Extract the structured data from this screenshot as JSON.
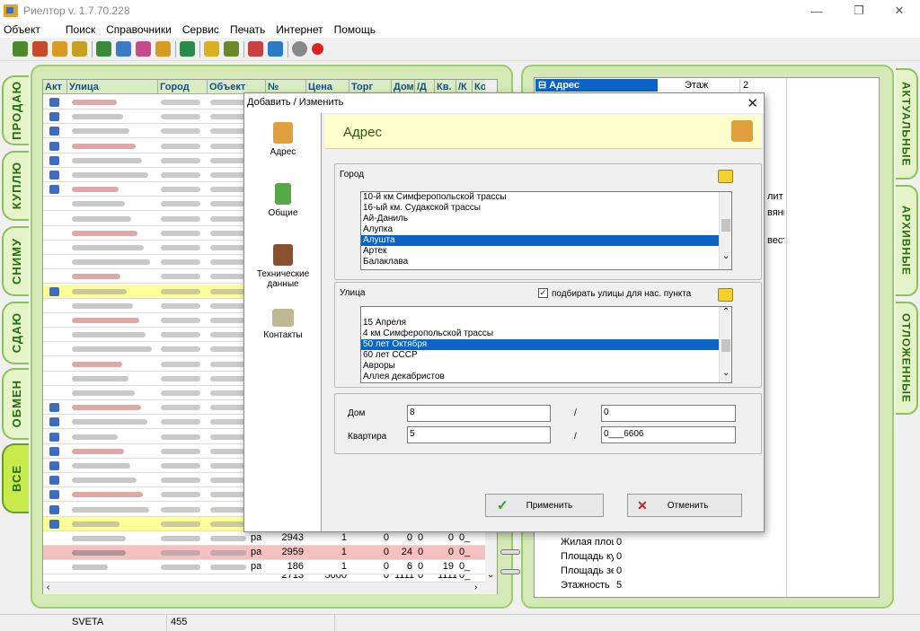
{
  "window": {
    "title": "Риелтор  v. 1.7.70.228",
    "controls": {
      "minimize": "—",
      "maximize": "❐",
      "close": "✕"
    }
  },
  "menu": [
    "Объект",
    "Поиск",
    "Справочники",
    "Сервис",
    "Печать",
    "Интернет",
    "Помощь"
  ],
  "toolbar_colors": [
    "#4a8a2a",
    "#c84a2a",
    "#d89a20",
    "#3a8a3a",
    "#c8a020",
    "#3a7ac8",
    "#c84a8a",
    "#2a8a4a",
    "#d8b020",
    "#6a8a2a",
    "#c84040",
    "#2a7ac8",
    "#888888",
    "#dd2222"
  ],
  "left_tabs": [
    {
      "label": "ПРОДАЮ",
      "active": false
    },
    {
      "label": "КУПЛЮ",
      "active": false
    },
    {
      "label": "СНИМУ",
      "active": false
    },
    {
      "label": "СДАЮ",
      "active": false
    },
    {
      "label": "ОБМЕН",
      "active": false
    },
    {
      "label": "ВСЕ",
      "active": true
    }
  ],
  "right_tabs": [
    "АКТУАЛЬНЫЕ",
    "АРХИВНЫЕ",
    "ОТЛОЖЕННЫЕ"
  ],
  "grid": {
    "columns": [
      "Акт",
      "Улица",
      "Город",
      "Объект",
      "№",
      "Цена",
      "Торг",
      "Дом",
      "/Д",
      "Кв.",
      "/К",
      "Ко"
    ],
    "visible_rows": [
      {
        "obj": "ра",
        "num": "2943",
        "price": "1",
        "torg": "0",
        "dom": "0",
        "dd": "0",
        "kv": "0",
        "kk": "0_"
      },
      {
        "obj": "ра",
        "num": "2959",
        "price": "1",
        "torg": "0",
        "dom": "24",
        "dd": "0",
        "kv": "0",
        "kk": "0_"
      },
      {
        "obj": "ра",
        "num": "186",
        "price": "1",
        "torg": "0",
        "dom": "6",
        "dd": "0",
        "kv": "19",
        "kk": "0_"
      },
      {
        "obj": "",
        "num": "2713",
        "price": "5000",
        "torg": "0",
        "dom": "1111",
        "dd": "0",
        "kv": "1111",
        "kk": "0_"
      }
    ]
  },
  "props": {
    "header": "Адрес",
    "floor_label": "Этаж",
    "floor_value": "2",
    "partial": [
      "лит",
      "вянн",
      "вест"
    ],
    "rows": [
      {
        "label": "Жилая площ",
        "value": "0"
      },
      {
        "label": "Площадь ку",
        "value": "0"
      },
      {
        "label": "Площадь зе",
        "value": "0"
      },
      {
        "label": "Этажность",
        "value": "5"
      }
    ]
  },
  "dialog": {
    "title": "Добавить / Изменить",
    "close": "✕",
    "nav": [
      "Адрес",
      "Общие",
      "Технические данные",
      "Контакты"
    ],
    "header": "Адрес",
    "city": {
      "label": "Город",
      "items": [
        "10-й км Симферопольской трассы",
        "16-ый км. Судакской трассы",
        "Ай-Даниль",
        "Алупка",
        "Алушта",
        "Артек",
        "Балаклава"
      ],
      "selected": 4
    },
    "street": {
      "label": "Улица",
      "checkbox_label": "подбирать улицы для нас. пункта",
      "checked": true,
      "items": [
        "15 Апреля",
        "4 км Симферопольской трассы",
        "50 лет Октября",
        "60 лет СССР",
        "Авроры",
        "Аллея декабристов"
      ],
      "selected": 2
    },
    "house": {
      "label": "Дом",
      "value": "8",
      "slash": "/",
      "suffix": "0"
    },
    "flat": {
      "label": "Квартира",
      "value": "5",
      "slash": "/",
      "suffix": "0___6606"
    },
    "apply": "Применить",
    "cancel": "Отменить"
  },
  "status": {
    "user": "SVETA",
    "count": "455"
  }
}
